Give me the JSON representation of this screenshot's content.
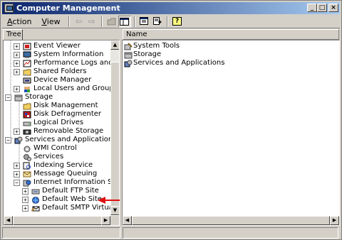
{
  "window": {
    "title": "Computer Management",
    "buttons": {
      "minimize": "_",
      "maximize": "□",
      "close": "×"
    }
  },
  "menu": {
    "action": {
      "accel": "A",
      "rest": "ction"
    },
    "view": {
      "accel": "V",
      "rest": "iew"
    }
  },
  "toolbar": {
    "back_icon": "⇦",
    "forward_icon": "⇨",
    "help_icon": "?"
  },
  "tree": {
    "header": "Tree",
    "items": [
      {
        "label": "Event Viewer",
        "icon": "event-viewer-icon",
        "expander": "+"
      },
      {
        "label": "System Information",
        "icon": "system-information-icon",
        "expander": "+"
      },
      {
        "label": "Performance Logs and Alerts",
        "icon": "performance-logs-icon",
        "expander": "+"
      },
      {
        "label": "Shared Folders",
        "icon": "shared-folders-icon",
        "expander": "+"
      },
      {
        "label": "Device Manager",
        "icon": "device-manager-icon",
        "expander": ""
      },
      {
        "label": "Local Users and Groups",
        "icon": "local-users-icon",
        "expander": "+"
      },
      {
        "label": "Storage",
        "icon": "storage-icon",
        "expander": "−"
      },
      {
        "label": "Disk Management",
        "icon": "disk-management-icon",
        "expander": ""
      },
      {
        "label": "Disk Defragmenter",
        "icon": "disk-defragmenter-icon",
        "expander": ""
      },
      {
        "label": "Logical Drives",
        "icon": "logical-drives-icon",
        "expander": ""
      },
      {
        "label": "Removable Storage",
        "icon": "removable-storage-icon",
        "expander": "+"
      },
      {
        "label": "Services and Applications",
        "icon": "services-applications-icon",
        "expander": "−"
      },
      {
        "label": "WMI Control",
        "icon": "wmi-control-icon",
        "expander": ""
      },
      {
        "label": "Services",
        "icon": "services-icon",
        "expander": ""
      },
      {
        "label": "Indexing Service",
        "icon": "indexing-service-icon",
        "expander": "+"
      },
      {
        "label": "Message Queuing",
        "icon": "message-queuing-icon",
        "expander": "+"
      },
      {
        "label": "Internet Information Services",
        "icon": "iis-icon",
        "expander": "−"
      },
      {
        "label": "Default FTP Site",
        "icon": "ftp-site-icon",
        "expander": "+"
      },
      {
        "label": "Default Web Site",
        "icon": "web-site-icon",
        "expander": "+"
      },
      {
        "label": "Default SMTP Virtual Serv",
        "icon": "smtp-server-icon",
        "expander": "+"
      }
    ]
  },
  "list": {
    "header": "Name",
    "items": [
      {
        "label": "System Tools",
        "icon": "system-tools-icon"
      },
      {
        "label": "Storage",
        "icon": "storage-icon"
      },
      {
        "label": "Services and Applications",
        "icon": "services-applications-icon"
      }
    ]
  },
  "colors": {
    "title_gradient_start": "#0a246a",
    "title_gradient_end": "#a6caf0",
    "window_face": "#d4d0c8",
    "annotation_arrow": "#e01010"
  }
}
